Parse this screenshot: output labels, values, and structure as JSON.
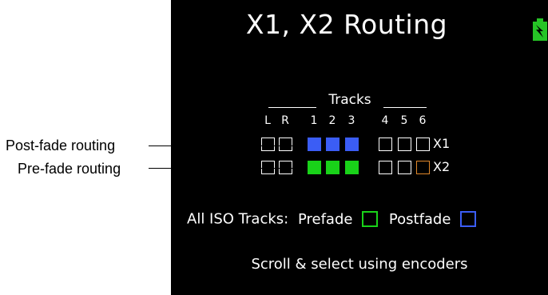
{
  "screen": {
    "title": "X1, X2 Routing",
    "battery_icon": "battery-charging-icon",
    "tracks_label": "Tracks",
    "columns": [
      "L",
      "R",
      "1",
      "2",
      "3",
      "4",
      "5",
      "6"
    ],
    "rows": [
      {
        "label": "X1",
        "cells": [
          "empty",
          "empty",
          "blue",
          "blue",
          "blue",
          "empty",
          "empty",
          "empty"
        ]
      },
      {
        "label": "X2",
        "cells": [
          "empty",
          "empty",
          "green",
          "green",
          "green",
          "empty",
          "empty",
          "orange"
        ]
      }
    ],
    "iso": {
      "label": "All ISO Tracks:",
      "prefade_label": "Prefade",
      "postfade_label": "Postfade"
    },
    "footer": "Scroll & select using encoders"
  },
  "callouts": {
    "post_fade": "Post-fade routing",
    "pre_fade": "Pre-fade routing"
  },
  "colors": {
    "blue": "#3b5df5",
    "green": "#19d219",
    "orange": "#e0872a",
    "battery": "#26c426",
    "screen_bg": "#000000"
  }
}
